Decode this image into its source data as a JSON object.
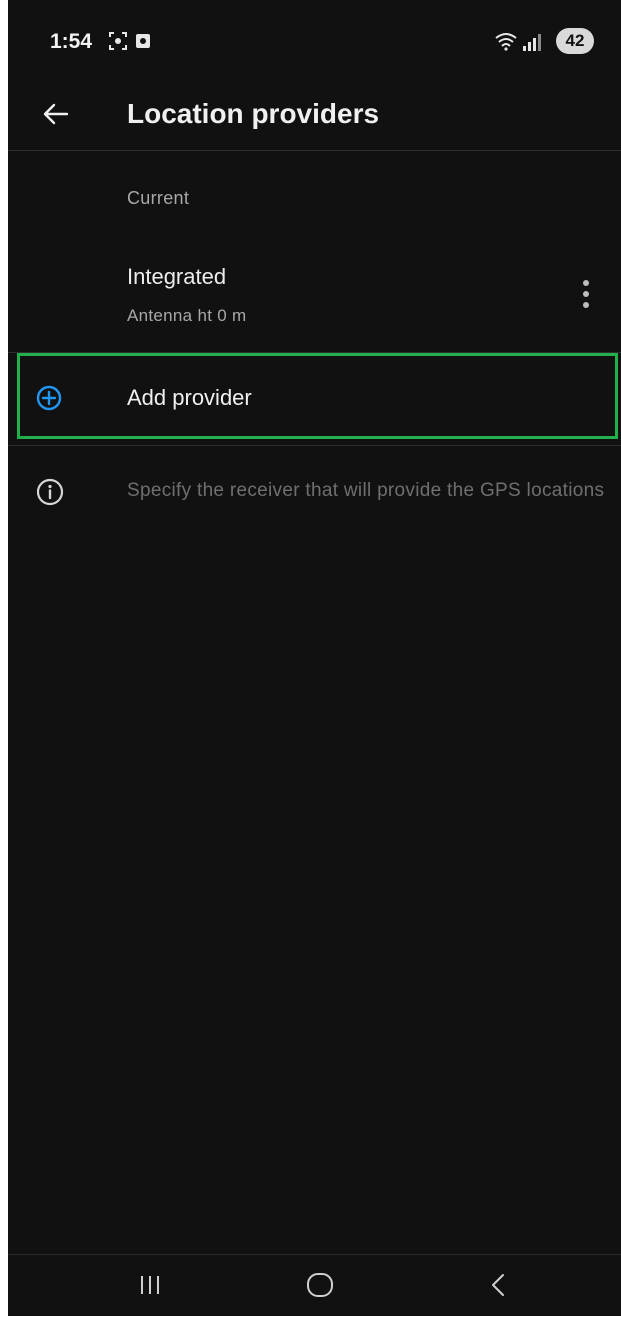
{
  "status_bar": {
    "time": "1:54",
    "battery": "42",
    "icons": [
      "screenshot-icon",
      "record-icon",
      "wifi-icon",
      "signal-icon"
    ]
  },
  "app_bar": {
    "title": "Location providers",
    "back_icon": "arrow-left-icon"
  },
  "section": {
    "label": "Current"
  },
  "provider": {
    "name": "Integrated",
    "subtitle": "Antenna ht 0 m",
    "menu_icon": "more-vertical-icon"
  },
  "add_provider": {
    "label": "Add provider",
    "icon": "add-circle-icon"
  },
  "info": {
    "text": "Specify the receiver that will provide the GPS locations",
    "icon": "info-icon"
  },
  "nav_bar": {
    "icons": [
      "recents-icon",
      "home-icon",
      "back-icon"
    ]
  },
  "colors": {
    "background": "#111111",
    "accent": "#2196f3",
    "highlight": "#22b04a",
    "primary_text": "#ececec",
    "secondary_text": "#a8a8a8",
    "hint_text": "#6f6f6f"
  }
}
